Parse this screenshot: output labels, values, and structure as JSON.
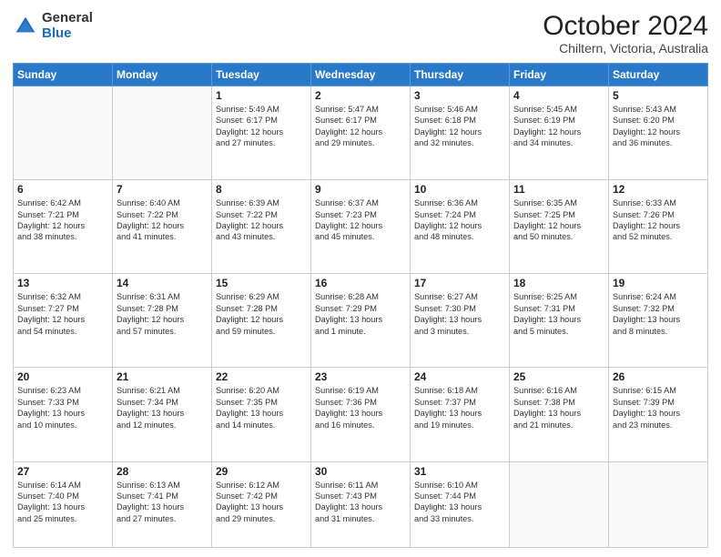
{
  "header": {
    "logo": {
      "line1": "General",
      "line2": "Blue"
    },
    "title": "October 2024",
    "subtitle": "Chiltern, Victoria, Australia"
  },
  "weekdays": [
    "Sunday",
    "Monday",
    "Tuesday",
    "Wednesday",
    "Thursday",
    "Friday",
    "Saturday"
  ],
  "weeks": [
    [
      {
        "day": "",
        "info": ""
      },
      {
        "day": "",
        "info": ""
      },
      {
        "day": "1",
        "info": "Sunrise: 5:49 AM\nSunset: 6:17 PM\nDaylight: 12 hours\nand 27 minutes."
      },
      {
        "day": "2",
        "info": "Sunrise: 5:47 AM\nSunset: 6:17 PM\nDaylight: 12 hours\nand 29 minutes."
      },
      {
        "day": "3",
        "info": "Sunrise: 5:46 AM\nSunset: 6:18 PM\nDaylight: 12 hours\nand 32 minutes."
      },
      {
        "day": "4",
        "info": "Sunrise: 5:45 AM\nSunset: 6:19 PM\nDaylight: 12 hours\nand 34 minutes."
      },
      {
        "day": "5",
        "info": "Sunrise: 5:43 AM\nSunset: 6:20 PM\nDaylight: 12 hours\nand 36 minutes."
      }
    ],
    [
      {
        "day": "6",
        "info": "Sunrise: 6:42 AM\nSunset: 7:21 PM\nDaylight: 12 hours\nand 38 minutes."
      },
      {
        "day": "7",
        "info": "Sunrise: 6:40 AM\nSunset: 7:22 PM\nDaylight: 12 hours\nand 41 minutes."
      },
      {
        "day": "8",
        "info": "Sunrise: 6:39 AM\nSunset: 7:22 PM\nDaylight: 12 hours\nand 43 minutes."
      },
      {
        "day": "9",
        "info": "Sunrise: 6:37 AM\nSunset: 7:23 PM\nDaylight: 12 hours\nand 45 minutes."
      },
      {
        "day": "10",
        "info": "Sunrise: 6:36 AM\nSunset: 7:24 PM\nDaylight: 12 hours\nand 48 minutes."
      },
      {
        "day": "11",
        "info": "Sunrise: 6:35 AM\nSunset: 7:25 PM\nDaylight: 12 hours\nand 50 minutes."
      },
      {
        "day": "12",
        "info": "Sunrise: 6:33 AM\nSunset: 7:26 PM\nDaylight: 12 hours\nand 52 minutes."
      }
    ],
    [
      {
        "day": "13",
        "info": "Sunrise: 6:32 AM\nSunset: 7:27 PM\nDaylight: 12 hours\nand 54 minutes."
      },
      {
        "day": "14",
        "info": "Sunrise: 6:31 AM\nSunset: 7:28 PM\nDaylight: 12 hours\nand 57 minutes."
      },
      {
        "day": "15",
        "info": "Sunrise: 6:29 AM\nSunset: 7:28 PM\nDaylight: 12 hours\nand 59 minutes."
      },
      {
        "day": "16",
        "info": "Sunrise: 6:28 AM\nSunset: 7:29 PM\nDaylight: 13 hours\nand 1 minute."
      },
      {
        "day": "17",
        "info": "Sunrise: 6:27 AM\nSunset: 7:30 PM\nDaylight: 13 hours\nand 3 minutes."
      },
      {
        "day": "18",
        "info": "Sunrise: 6:25 AM\nSunset: 7:31 PM\nDaylight: 13 hours\nand 5 minutes."
      },
      {
        "day": "19",
        "info": "Sunrise: 6:24 AM\nSunset: 7:32 PM\nDaylight: 13 hours\nand 8 minutes."
      }
    ],
    [
      {
        "day": "20",
        "info": "Sunrise: 6:23 AM\nSunset: 7:33 PM\nDaylight: 13 hours\nand 10 minutes."
      },
      {
        "day": "21",
        "info": "Sunrise: 6:21 AM\nSunset: 7:34 PM\nDaylight: 13 hours\nand 12 minutes."
      },
      {
        "day": "22",
        "info": "Sunrise: 6:20 AM\nSunset: 7:35 PM\nDaylight: 13 hours\nand 14 minutes."
      },
      {
        "day": "23",
        "info": "Sunrise: 6:19 AM\nSunset: 7:36 PM\nDaylight: 13 hours\nand 16 minutes."
      },
      {
        "day": "24",
        "info": "Sunrise: 6:18 AM\nSunset: 7:37 PM\nDaylight: 13 hours\nand 19 minutes."
      },
      {
        "day": "25",
        "info": "Sunrise: 6:16 AM\nSunset: 7:38 PM\nDaylight: 13 hours\nand 21 minutes."
      },
      {
        "day": "26",
        "info": "Sunrise: 6:15 AM\nSunset: 7:39 PM\nDaylight: 13 hours\nand 23 minutes."
      }
    ],
    [
      {
        "day": "27",
        "info": "Sunrise: 6:14 AM\nSunset: 7:40 PM\nDaylight: 13 hours\nand 25 minutes."
      },
      {
        "day": "28",
        "info": "Sunrise: 6:13 AM\nSunset: 7:41 PM\nDaylight: 13 hours\nand 27 minutes."
      },
      {
        "day": "29",
        "info": "Sunrise: 6:12 AM\nSunset: 7:42 PM\nDaylight: 13 hours\nand 29 minutes."
      },
      {
        "day": "30",
        "info": "Sunrise: 6:11 AM\nSunset: 7:43 PM\nDaylight: 13 hours\nand 31 minutes."
      },
      {
        "day": "31",
        "info": "Sunrise: 6:10 AM\nSunset: 7:44 PM\nDaylight: 13 hours\nand 33 minutes."
      },
      {
        "day": "",
        "info": ""
      },
      {
        "day": "",
        "info": ""
      }
    ]
  ]
}
